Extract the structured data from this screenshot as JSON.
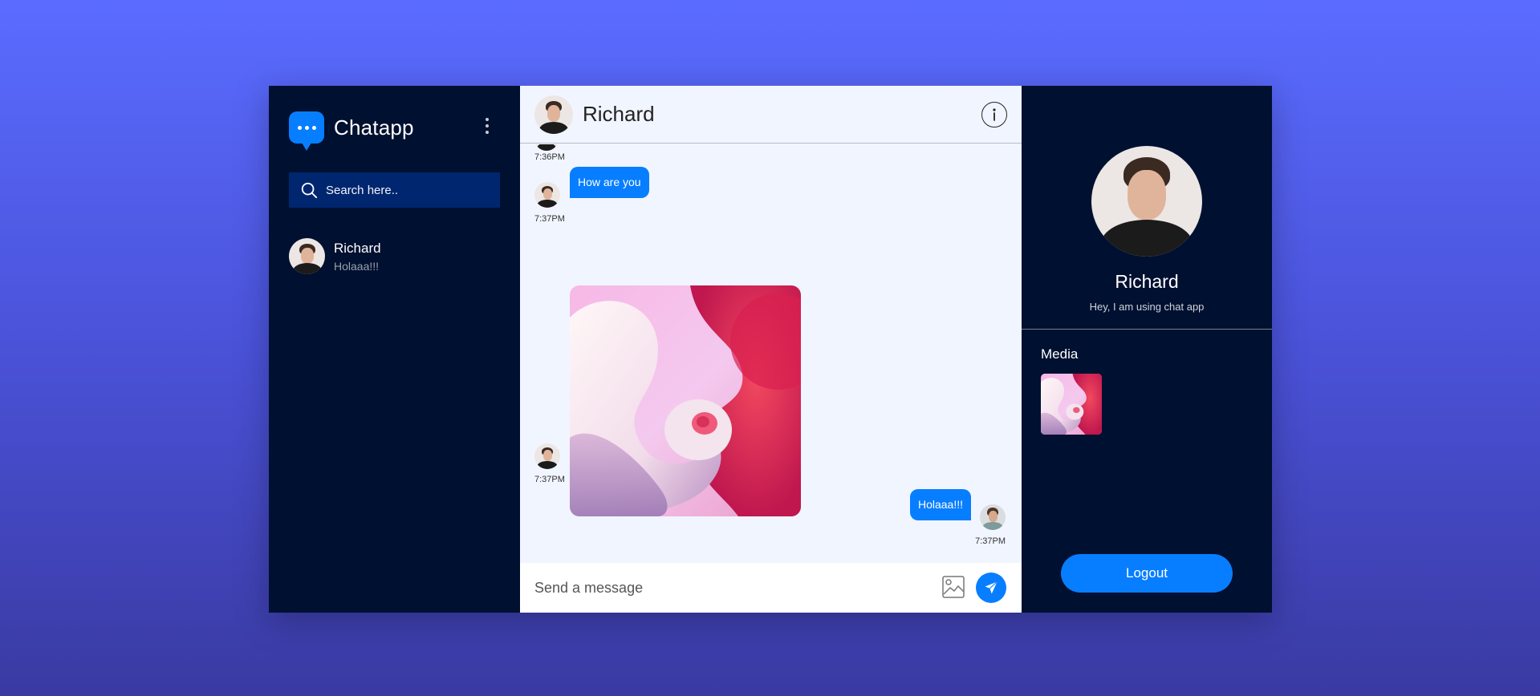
{
  "brand": {
    "name": "Chatapp"
  },
  "search": {
    "placeholder": "Search here.."
  },
  "friends": [
    {
      "name": "Richard",
      "last_message": "Holaaa!!!"
    }
  ],
  "chat": {
    "header_name": "Richard",
    "messages": [
      {
        "type": "time-only",
        "time": "7:36PM"
      },
      {
        "type": "text",
        "direction": "incoming",
        "text": "How are you",
        "time": "7:37PM"
      },
      {
        "type": "image",
        "direction": "incoming",
        "time": "7:37PM"
      },
      {
        "type": "text",
        "direction": "outgoing",
        "text": "Holaaa!!!",
        "time": "7:37PM"
      }
    ],
    "composer_placeholder": "Send a message"
  },
  "profile": {
    "name": "Richard",
    "bio": "Hey, I am using chat app",
    "media_title": "Media",
    "logout_label": "Logout"
  },
  "colors": {
    "accent": "#077eff",
    "sidebar_bg": "#001030",
    "chat_bg": "#f1f5ff",
    "search_bg": "#002670"
  }
}
